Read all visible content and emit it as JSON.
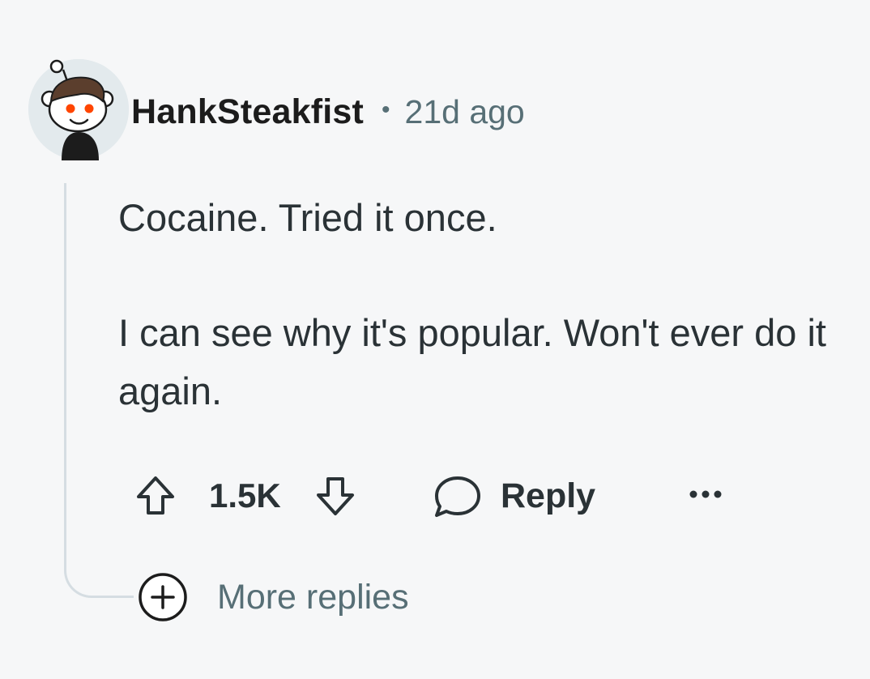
{
  "comment": {
    "author": "HankSteakfist",
    "separator": "•",
    "timestamp": "21d ago",
    "paragraphs": [
      "Cocaine. Tried it once.",
      "I can see why it's popular. Won't ever do it again."
    ]
  },
  "actions": {
    "score": "1.5K",
    "reply_label": "Reply",
    "upvote_icon": "arrow-up-outline-icon",
    "downvote_icon": "arrow-down-outline-icon",
    "reply_icon": "speech-bubble-icon",
    "more_icon": "ellipsis-icon"
  },
  "more_replies": {
    "label": "More replies",
    "icon": "plus-circle-icon"
  },
  "colors": {
    "background": "#f6f7f8",
    "text_primary": "#2a3236",
    "text_secondary": "#576f76",
    "thread_line": "#d5dde2",
    "avatar_accent": "#ff4500"
  }
}
